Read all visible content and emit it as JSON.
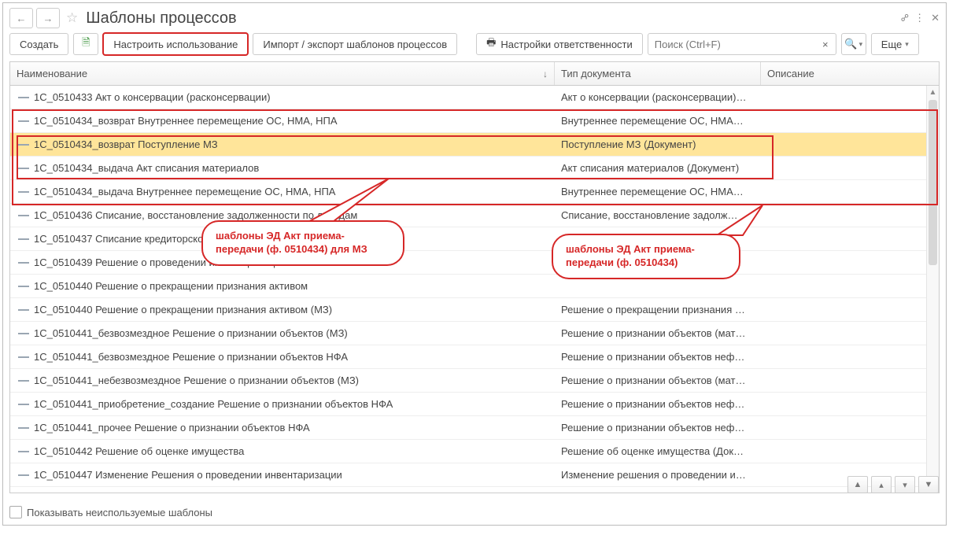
{
  "title": "Шаблоны процессов",
  "toolbar": {
    "create": "Создать",
    "configure": "Настроить использование",
    "import_export": "Импорт / экспорт шаблонов процессов",
    "responsibility": "Настройки ответственности",
    "more": "Еще"
  },
  "search": {
    "placeholder": "Поиск (Ctrl+F)"
  },
  "columns": {
    "name": "Наименование",
    "doc": "Тип документа",
    "desc": "Описание"
  },
  "rows": [
    {
      "name": "1С_0510433 Акт о консервации (расконсервации)",
      "doc": "Акт о консервации (расконсервации)…"
    },
    {
      "name": "1С_0510434_возврат Внутреннее перемещение ОС, НМА, НПА",
      "doc": "Внутреннее перемещение ОС, НМА…"
    },
    {
      "name": "1С_0510434_возврат Поступление МЗ",
      "doc": "Поступление МЗ (Документ)",
      "selected": true
    },
    {
      "name": "1С_0510434_выдача Акт списания материалов",
      "doc": "Акт списания материалов (Документ)"
    },
    {
      "name": "1С_0510434_выдача Внутреннее перемещение ОС, НМА, НПА",
      "doc": "Внутреннее перемещение ОС, НМА…"
    },
    {
      "name": "1С_0510436 Списание, восстановление задолженности по доходам",
      "doc": "Списание, восстановление задолж…"
    },
    {
      "name": "1С_0510437 Списание кредиторской задолженности",
      "doc": ""
    },
    {
      "name": "1С_0510439 Решение о проведении инвентаризации",
      "doc": ""
    },
    {
      "name": "1С_0510440 Решение о прекращении признания активом",
      "doc": ""
    },
    {
      "name": "1С_0510440 Решение о прекращении признания активом (МЗ)",
      "doc": "Решение о прекращении признания …"
    },
    {
      "name": "1С_0510441_безвозмездное Решение о признании объектов (МЗ)",
      "doc": "Решение о признании объектов (мат…"
    },
    {
      "name": "1С_0510441_безвозмездное Решение о признании объектов НФА",
      "doc": "Решение о признании объектов неф…"
    },
    {
      "name": "1С_0510441_небезвозмездное Решение о признании объектов (МЗ)",
      "doc": "Решение о признании объектов (мат…"
    },
    {
      "name": "1С_0510441_приобретение_создание Решение о признании объектов НФА",
      "doc": "Решение о признании объектов неф…"
    },
    {
      "name": "1С_0510441_прочее Решение о признании объектов НФА",
      "doc": "Решение о признании объектов неф…"
    },
    {
      "name": "1С_0510442 Решение об оценке имущества",
      "doc": "Решение об оценке имущества (Док…"
    },
    {
      "name": "1С_0510447 Изменение Решения о проведении инвентаризации",
      "doc": "Изменение решения о проведении и…"
    }
  ],
  "callouts": {
    "left": "шаблоны ЭД Акт приема-передачи (ф. 0510434) для МЗ",
    "right": "шаблоны ЭД Акт приема-передачи (ф. 0510434)"
  },
  "footer": {
    "checkbox_label": "Показывать неиспользуемые шаблоны"
  }
}
